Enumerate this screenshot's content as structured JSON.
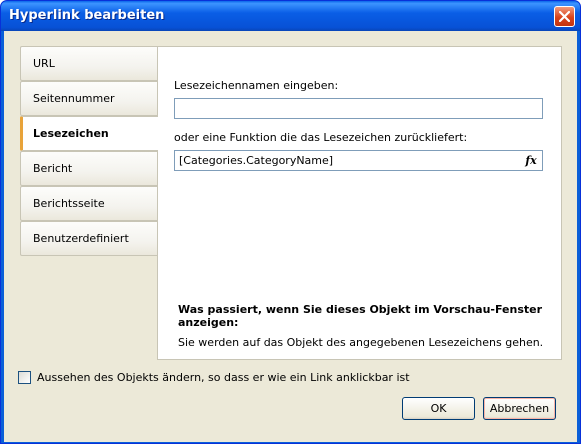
{
  "window": {
    "title": "Hyperlink bearbeiten"
  },
  "tabs": [
    {
      "label": "URL",
      "active": false
    },
    {
      "label": "Seitennummer",
      "active": false
    },
    {
      "label": "Lesezeichen",
      "active": true
    },
    {
      "label": "Bericht",
      "active": false
    },
    {
      "label": "Berichtsseite",
      "active": false
    },
    {
      "label": "Benutzerdefiniert",
      "active": false
    }
  ],
  "panel": {
    "bookmark_name_label": "Lesezeichennamen eingeben:",
    "bookmark_name_value": "",
    "function_label": "oder eine Funktion die das Lesezeichen zurückliefert:",
    "function_value": "[Categories.CategoryName]",
    "function_button_icon": "fx",
    "info_title": "Was passiert, wenn Sie dieses Objekt im Vorschau-Fenster anzeigen:",
    "info_text": "Sie werden auf das Objekt des angegebenen Lesezeichens gehen."
  },
  "footer": {
    "checkbox_label": "Aussehen des Objekts ändern, so dass er wie ein Link anklickbar ist",
    "checkbox_checked": false,
    "ok_label": "OK",
    "cancel_label": "Abbrechen"
  },
  "colors": {
    "title_bar": "#0a5ee6",
    "client_bg": "#ece9d8",
    "active_tab_accent": "#e8a33a",
    "close_button": "#d9431b"
  }
}
